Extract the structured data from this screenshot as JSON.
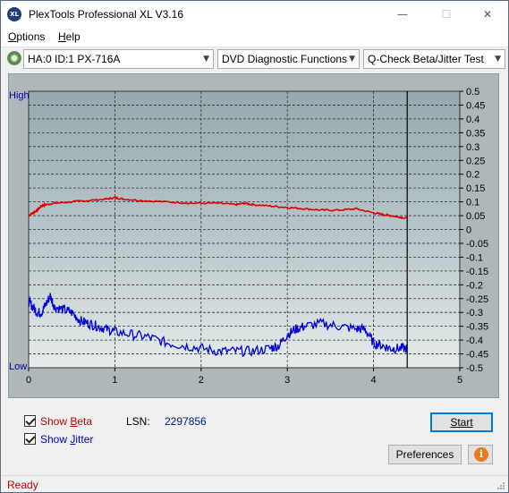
{
  "window": {
    "title": "PlexTools Professional XL V3.16",
    "icon_label": "XL",
    "minimize_glyph": "—",
    "maximize_glyph": "☐",
    "close_glyph": "✕"
  },
  "menu": {
    "options": {
      "accel": "O",
      "rest": "ptions"
    },
    "help": {
      "accel": "H",
      "rest": "elp"
    }
  },
  "toolbar": {
    "drive": "HA:0 ID:1  PX-716A",
    "function": "DVD Diagnostic Functions",
    "test": "Q-Check Beta/Jitter Test"
  },
  "chart_data": {
    "type": "line",
    "high_label": "High",
    "low_label": "Low",
    "x_ticks": [
      "0",
      "1",
      "2",
      "3",
      "4",
      "5"
    ],
    "xlim": [
      0,
      5
    ],
    "y_right_ticks": [
      "0.5",
      "0.45",
      "0.4",
      "0.35",
      "0.3",
      "0.25",
      "0.2",
      "0.15",
      "0.1",
      "0.05",
      "0",
      "-0.05",
      "-0.1",
      "-0.15",
      "-0.2",
      "-0.25",
      "-0.3",
      "-0.35",
      "-0.4",
      "-0.45",
      "-0.5"
    ],
    "ylim": [
      -0.5,
      0.5
    ],
    "end_marker_x": 4.39,
    "grid": true,
    "series": [
      {
        "color": "#e00000",
        "x": [
          0,
          0.05,
          0.1,
          0.15,
          0.2,
          0.3,
          0.5,
          0.7,
          0.9,
          1.0,
          1.1,
          1.3,
          1.6,
          1.9,
          2.2,
          2.4,
          2.5,
          2.6,
          2.8,
          3.0,
          3.2,
          3.4,
          3.6,
          3.8,
          4.0,
          4.1,
          4.2,
          4.3,
          4.39
        ],
        "y": [
          0.05,
          0.06,
          0.07,
          0.085,
          0.09,
          0.095,
          0.1,
          0.105,
          0.11,
          0.115,
          0.11,
          0.105,
          0.1,
          0.095,
          0.095,
          0.09,
          0.095,
          0.09,
          0.085,
          0.08,
          0.075,
          0.07,
          0.07,
          0.075,
          0.06,
          0.055,
          0.05,
          0.045,
          0.04
        ]
      },
      {
        "color": "#0000e0",
        "x": [
          0,
          0.05,
          0.1,
          0.15,
          0.2,
          0.25,
          0.3,
          0.4,
          0.5,
          0.6,
          0.7,
          0.8,
          0.9,
          1.0,
          1.2,
          1.4,
          1.6,
          1.8,
          2.0,
          2.2,
          2.4,
          2.6,
          2.8,
          2.9,
          3.0,
          3.1,
          3.2,
          3.4,
          3.6,
          3.8,
          3.9,
          4.0,
          4.1,
          4.2,
          4.3,
          4.39
        ],
        "y": [
          -0.26,
          -0.28,
          -0.3,
          -0.3,
          -0.27,
          -0.24,
          -0.28,
          -0.29,
          -0.3,
          -0.33,
          -0.34,
          -0.35,
          -0.36,
          -0.37,
          -0.38,
          -0.39,
          -0.41,
          -0.42,
          -0.43,
          -0.44,
          -0.44,
          -0.44,
          -0.43,
          -0.42,
          -0.38,
          -0.36,
          -0.35,
          -0.34,
          -0.35,
          -0.36,
          -0.36,
          -0.41,
          -0.42,
          -0.43,
          -0.43,
          -0.43
        ]
      }
    ]
  },
  "controls": {
    "show_beta": {
      "pre": "Show ",
      "accel": "B",
      "post": "eta",
      "color": "#c00000",
      "checked": true
    },
    "show_jitter": {
      "pre": "Show ",
      "accel": "J",
      "post": "itter",
      "color": "#0000c0",
      "checked": true
    },
    "lsn_label": "LSN:",
    "lsn_value": "2297856",
    "start_label": "Start",
    "preferences_label": "Preferences",
    "info_glyph": "i"
  },
  "status": {
    "text": "Ready"
  }
}
